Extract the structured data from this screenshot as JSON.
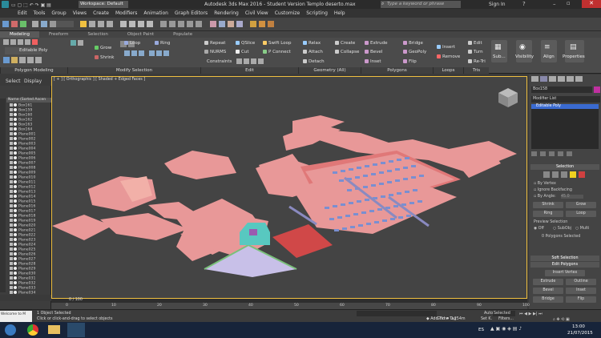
{
  "title_bar": {
    "workspace": "Workspace: Default",
    "title": "Autodesk 3ds Max 2016 - Student Version    Templo deserto.max",
    "search_placeholder": "Type a keyword or phrase",
    "sign_in": "Sign In"
  },
  "menu": [
    "Edit",
    "Tools",
    "Group",
    "Views",
    "Create",
    "Modifiers",
    "Animation",
    "Graph Editors",
    "Rendering",
    "Civil View",
    "Customize",
    "Scripting",
    "Help"
  ],
  "ribbon_tabs": [
    "Modeling",
    "Freeform",
    "Selection",
    "Object Paint",
    "Populate"
  ],
  "ribbon": {
    "editable_poly": "Editable Poly",
    "grow": "Grow",
    "shrink": "Shrink",
    "loop": "Loop",
    "ring": "Ring",
    "repeat": "Repeat",
    "qslice": "QSlice",
    "swift_loop": "Swift Loop",
    "nurms": "NURMS",
    "cut": "Cut",
    "p_connect": "P Connect",
    "constraints": "Constraints",
    "relax": "Relax",
    "create": "Create",
    "attach": "Attach",
    "collapse": "Collapse",
    "detach": "Detach",
    "extrude": "Extrude",
    "bevel": "Bevel",
    "inset": "Inset",
    "bridge": "Bridge",
    "geopoly": "GeoPoly",
    "flip": "Flip",
    "insert": "Insert",
    "remove": "Remove",
    "edit": "Edit",
    "turn": "Turn",
    "re_tri": "Re-Tri",
    "subobj": "Sub...",
    "visibility": "Visibility",
    "align": "Align",
    "properties": "Properties",
    "groups": [
      "Polygon Modeling",
      "Modify Selection",
      "Edit",
      "Geometry (All)",
      "Polygons",
      "Loops",
      "Tris"
    ]
  },
  "scene_explorer": {
    "tabs": [
      "Select",
      "Display"
    ],
    "header": "Name (Sorted Ascen",
    "items": [
      "Box161",
      "Box159",
      "Box160",
      "Box162",
      "Box163",
      "Box164",
      "Plane001",
      "Plane002",
      "Plane003",
      "Plane004",
      "Plane005",
      "Plane006",
      "Plane007",
      "Plane008",
      "Plane009",
      "Plane010",
      "Plane011",
      "Plane012",
      "Plane013",
      "Plane014",
      "Plane015",
      "Plane016",
      "Plane017",
      "Plane018",
      "Plane019",
      "Plane020",
      "Plane021",
      "Plane022",
      "Plane023",
      "Plane024",
      "Plane025",
      "Plane026",
      "Plane027",
      "Plane028",
      "Plane029",
      "Plane030",
      "Plane031",
      "Plane032",
      "Plane033",
      "Plane034",
      "Plane035"
    ]
  },
  "viewport": {
    "label": "[ + ] [ Orthographic ] [ Shaded + Edged Faces ]"
  },
  "command_panel": {
    "object_name": "Box158",
    "modifier_list": "Modifier List",
    "stack_item": "Editable Poly",
    "selection_title": "Selection",
    "by_vertex": "By Vertex",
    "ignore_backfacing": "Ignore Backfacing",
    "by_angle": "By Angle:",
    "angle_value": "45.0",
    "shrink": "Shrink",
    "grow": "Grow",
    "ring": "Ring",
    "loop": "Loop",
    "preview_selection": "Preview Selection",
    "preview_options": [
      "Off",
      "SubObj",
      "Multi"
    ],
    "selected_count": "0 Polygons Selected",
    "soft_selection": "Soft Selection",
    "edit_polygons": "Edit Polygons",
    "insert_vertex": "Insert Vertex",
    "extrude": "Extrude",
    "outline": "Outline",
    "bevel": "Bevel",
    "inset": "Inset",
    "bridge": "Bridge",
    "flip": "Flip"
  },
  "timeline": {
    "frame": "0 / 100",
    "ticks": [
      "0",
      "10",
      "20",
      "30",
      "40",
      "50",
      "60",
      "70",
      "80",
      "90",
      "100"
    ]
  },
  "status": {
    "object_selected": "1 Object Selected",
    "prompt": "Click or click-and-drag to select objects",
    "grid": "Grid = 0,254m",
    "auto": "Auto",
    "selected": "Selected",
    "set_key": "Set K.",
    "filters": "Filters...",
    "add_time_tag": "Add Time Tag",
    "maxscript": "Welcome to M"
  },
  "taskbar": {
    "lang": "ES",
    "time": "13:00",
    "date": "21/07/2015"
  },
  "colors": {
    "pink": "#e89898",
    "pink_dark": "#d07a7a",
    "red": "#d04848",
    "lilac": "#c8c0e8",
    "teal": "#58c8c0",
    "accent": "#f0c040"
  }
}
